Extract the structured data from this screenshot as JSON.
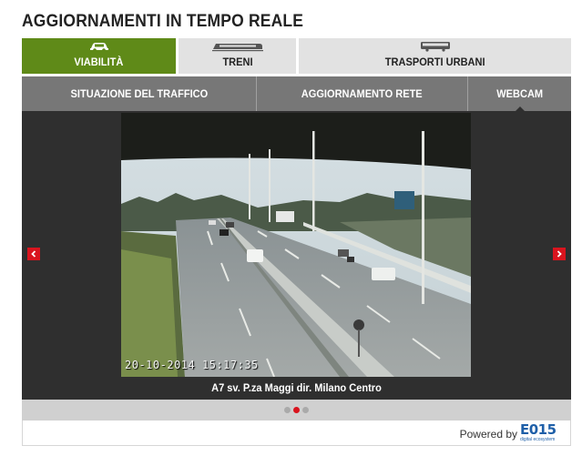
{
  "title": "AGGIORNAMENTI IN TEMPO REALE",
  "main_tabs": [
    {
      "label": "VIABILITÀ",
      "icon": "car-icon",
      "active": true
    },
    {
      "label": "TRENI",
      "icon": "train-icon",
      "active": false
    },
    {
      "label": "TRASPORTI URBANI",
      "icon": "bus-icon",
      "active": false
    }
  ],
  "sub_tabs": [
    {
      "label": "SITUAZIONE DEL TRAFFICO",
      "active": false
    },
    {
      "label": "AGGIORNAMENTO RETE",
      "active": false
    },
    {
      "label": "WEBCAM",
      "active": true
    }
  ],
  "webcam": {
    "timestamp": "20-10-2014 15:17:35",
    "caption": "A7 sv. P.za Maggi dir. Milano Centro",
    "slide_count": 3,
    "active_slide": 2
  },
  "footer": {
    "powered_by": "Powered by",
    "logo_text": "E015",
    "logo_sub": "digital ecosystem"
  },
  "colors": {
    "accent_green": "#5f8a18",
    "accent_red": "#d9141e",
    "subtab_bg": "#777777",
    "panel_bg": "#2f2f2f",
    "logo_blue": "#1e5fa8"
  }
}
